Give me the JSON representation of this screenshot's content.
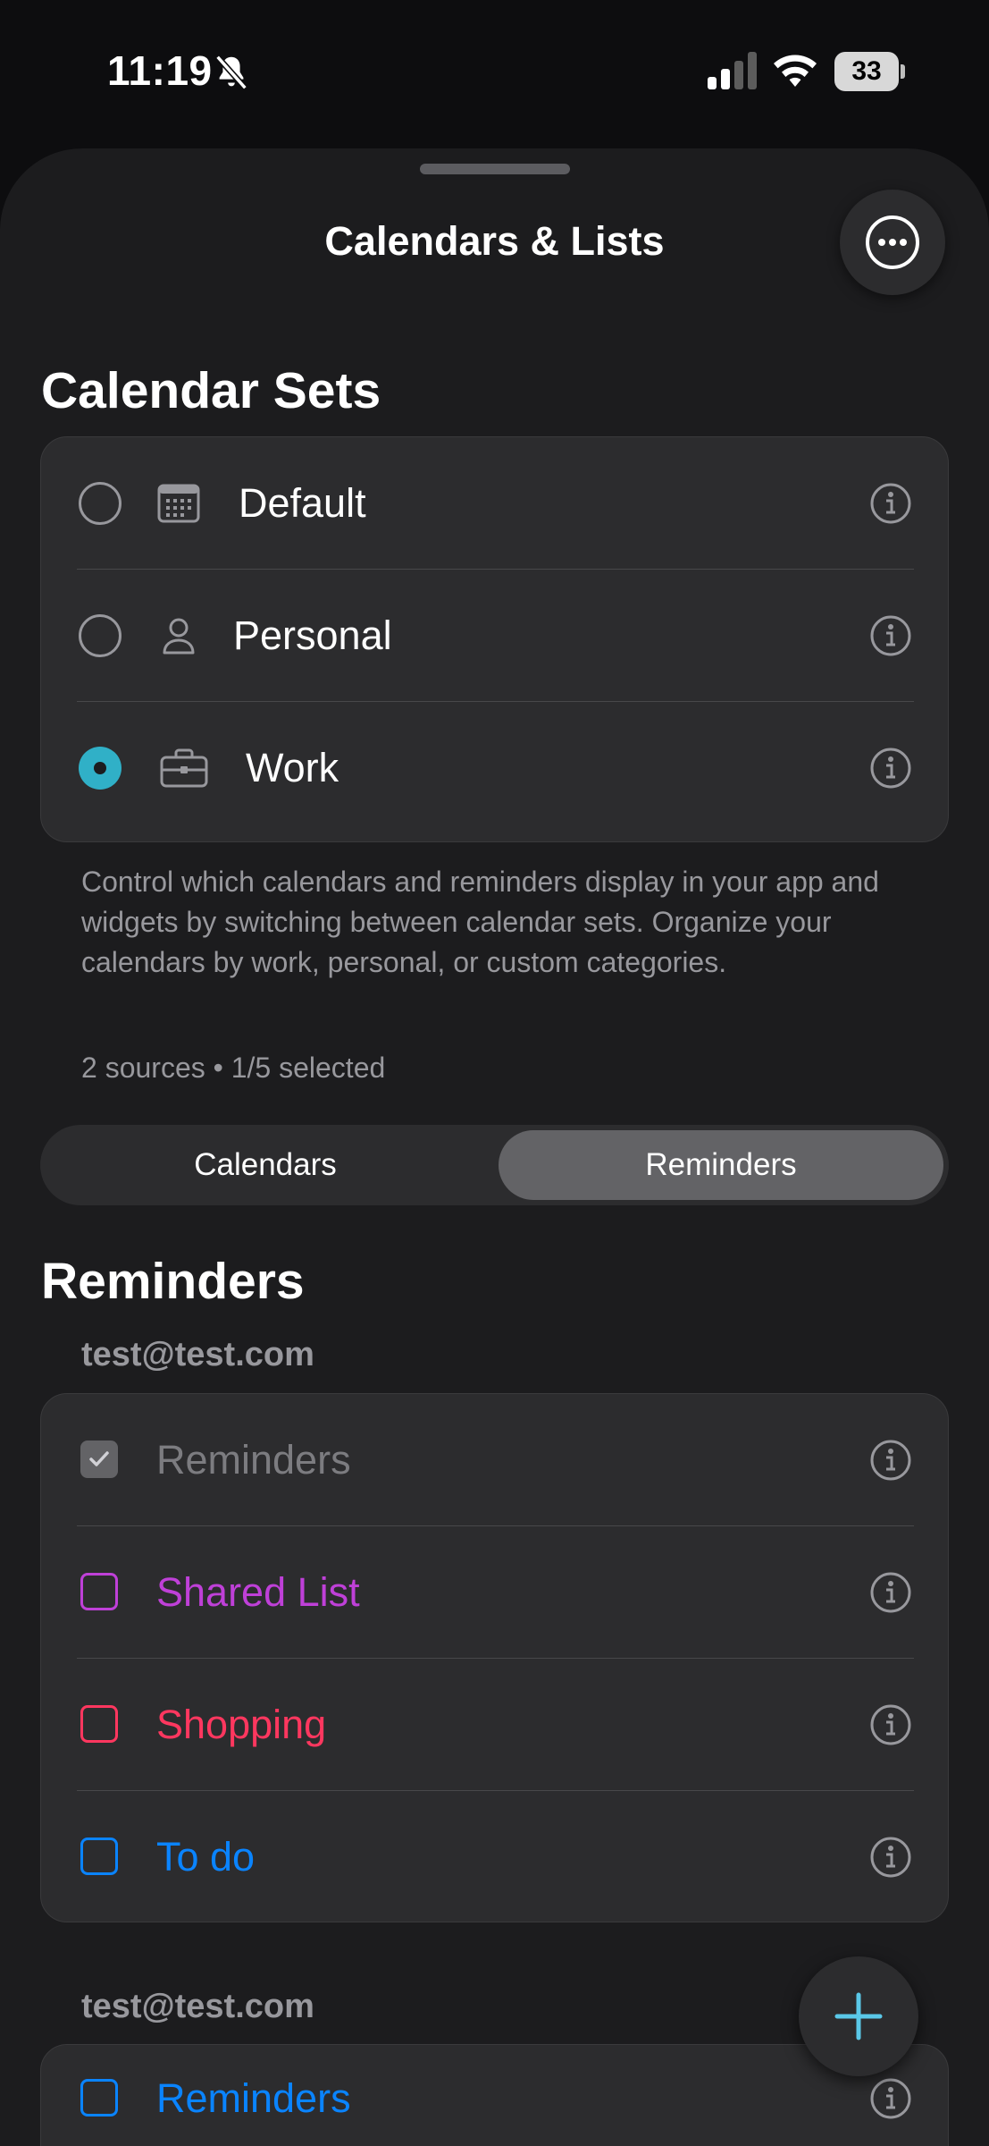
{
  "status_bar": {
    "time": "11:19",
    "battery": "33"
  },
  "sheet": {
    "title": "Calendars & Lists"
  },
  "calendar_sets": {
    "title": "Calendar Sets",
    "items": [
      {
        "label": "Default",
        "icon": "calendar-grid-icon",
        "selected": false
      },
      {
        "label": "Personal",
        "icon": "person-icon",
        "selected": false
      },
      {
        "label": "Work",
        "icon": "briefcase-icon",
        "selected": true
      }
    ],
    "caption": "Control which calendars and reminders display in your app and widgets by switching between calendar sets. Organize your calendars by work, personal, or custom categories.",
    "sources": "2 sources • 1/5 selected"
  },
  "segmented": {
    "calendars": "Calendars",
    "reminders": "Reminders",
    "selected": "Reminders"
  },
  "reminders_section": {
    "title": "Reminders",
    "accounts": [
      {
        "email": "test@test.com",
        "lists": [
          {
            "label": "Reminders",
            "color": "#7c7c80",
            "checked": true
          },
          {
            "label": "Shared List",
            "color": "#bf40d8",
            "checked": false
          },
          {
            "label": "Shopping",
            "color": "#ff375f",
            "checked": false
          },
          {
            "label": "To do",
            "color": "#0a84ff",
            "checked": false
          }
        ]
      },
      {
        "email": "test@test.com",
        "lists": [
          {
            "label": "Reminders",
            "color": "#0a84ff",
            "checked": false
          }
        ]
      }
    ]
  },
  "colors": {
    "accent": "#30b0c7",
    "background": "#1c1c1e",
    "group": "#2c2c2e"
  }
}
